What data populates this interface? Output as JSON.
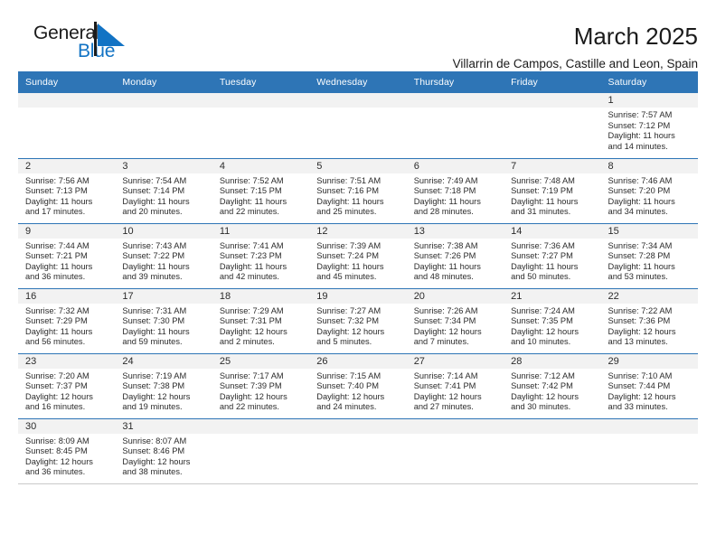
{
  "brand": {
    "name_part1": "General",
    "name_part2": "Blue",
    "logo_icon": "flag-triangle-icon",
    "color_primary": "#2e75b6",
    "color_text": "#1273c4"
  },
  "header": {
    "title": "March 2025",
    "subtitle": "Villarrin de Campos, Castille and Leon, Spain"
  },
  "weekdays": [
    "Sunday",
    "Monday",
    "Tuesday",
    "Wednesday",
    "Thursday",
    "Friday",
    "Saturday"
  ],
  "labels": {
    "sunrise": "Sunrise:",
    "sunset": "Sunset:",
    "daylight": "Daylight:"
  },
  "weeks": [
    [
      {
        "empty": true
      },
      {
        "empty": true
      },
      {
        "empty": true
      },
      {
        "empty": true
      },
      {
        "empty": true
      },
      {
        "empty": true
      },
      {
        "day": "1",
        "sunrise": "Sunrise: 7:57 AM",
        "sunset": "Sunset: 7:12 PM",
        "daylight1": "Daylight: 11 hours",
        "daylight2": "and 14 minutes."
      }
    ],
    [
      {
        "day": "2",
        "sunrise": "Sunrise: 7:56 AM",
        "sunset": "Sunset: 7:13 PM",
        "daylight1": "Daylight: 11 hours",
        "daylight2": "and 17 minutes."
      },
      {
        "day": "3",
        "sunrise": "Sunrise: 7:54 AM",
        "sunset": "Sunset: 7:14 PM",
        "daylight1": "Daylight: 11 hours",
        "daylight2": "and 20 minutes."
      },
      {
        "day": "4",
        "sunrise": "Sunrise: 7:52 AM",
        "sunset": "Sunset: 7:15 PM",
        "daylight1": "Daylight: 11 hours",
        "daylight2": "and 22 minutes."
      },
      {
        "day": "5",
        "sunrise": "Sunrise: 7:51 AM",
        "sunset": "Sunset: 7:16 PM",
        "daylight1": "Daylight: 11 hours",
        "daylight2": "and 25 minutes."
      },
      {
        "day": "6",
        "sunrise": "Sunrise: 7:49 AM",
        "sunset": "Sunset: 7:18 PM",
        "daylight1": "Daylight: 11 hours",
        "daylight2": "and 28 minutes."
      },
      {
        "day": "7",
        "sunrise": "Sunrise: 7:48 AM",
        "sunset": "Sunset: 7:19 PM",
        "daylight1": "Daylight: 11 hours",
        "daylight2": "and 31 minutes."
      },
      {
        "day": "8",
        "sunrise": "Sunrise: 7:46 AM",
        "sunset": "Sunset: 7:20 PM",
        "daylight1": "Daylight: 11 hours",
        "daylight2": "and 34 minutes."
      }
    ],
    [
      {
        "day": "9",
        "sunrise": "Sunrise: 7:44 AM",
        "sunset": "Sunset: 7:21 PM",
        "daylight1": "Daylight: 11 hours",
        "daylight2": "and 36 minutes."
      },
      {
        "day": "10",
        "sunrise": "Sunrise: 7:43 AM",
        "sunset": "Sunset: 7:22 PM",
        "daylight1": "Daylight: 11 hours",
        "daylight2": "and 39 minutes."
      },
      {
        "day": "11",
        "sunrise": "Sunrise: 7:41 AM",
        "sunset": "Sunset: 7:23 PM",
        "daylight1": "Daylight: 11 hours",
        "daylight2": "and 42 minutes."
      },
      {
        "day": "12",
        "sunrise": "Sunrise: 7:39 AM",
        "sunset": "Sunset: 7:24 PM",
        "daylight1": "Daylight: 11 hours",
        "daylight2": "and 45 minutes."
      },
      {
        "day": "13",
        "sunrise": "Sunrise: 7:38 AM",
        "sunset": "Sunset: 7:26 PM",
        "daylight1": "Daylight: 11 hours",
        "daylight2": "and 48 minutes."
      },
      {
        "day": "14",
        "sunrise": "Sunrise: 7:36 AM",
        "sunset": "Sunset: 7:27 PM",
        "daylight1": "Daylight: 11 hours",
        "daylight2": "and 50 minutes."
      },
      {
        "day": "15",
        "sunrise": "Sunrise: 7:34 AM",
        "sunset": "Sunset: 7:28 PM",
        "daylight1": "Daylight: 11 hours",
        "daylight2": "and 53 minutes."
      }
    ],
    [
      {
        "day": "16",
        "sunrise": "Sunrise: 7:32 AM",
        "sunset": "Sunset: 7:29 PM",
        "daylight1": "Daylight: 11 hours",
        "daylight2": "and 56 minutes."
      },
      {
        "day": "17",
        "sunrise": "Sunrise: 7:31 AM",
        "sunset": "Sunset: 7:30 PM",
        "daylight1": "Daylight: 11 hours",
        "daylight2": "and 59 minutes."
      },
      {
        "day": "18",
        "sunrise": "Sunrise: 7:29 AM",
        "sunset": "Sunset: 7:31 PM",
        "daylight1": "Daylight: 12 hours",
        "daylight2": "and 2 minutes."
      },
      {
        "day": "19",
        "sunrise": "Sunrise: 7:27 AM",
        "sunset": "Sunset: 7:32 PM",
        "daylight1": "Daylight: 12 hours",
        "daylight2": "and 5 minutes."
      },
      {
        "day": "20",
        "sunrise": "Sunrise: 7:26 AM",
        "sunset": "Sunset: 7:34 PM",
        "daylight1": "Daylight: 12 hours",
        "daylight2": "and 7 minutes."
      },
      {
        "day": "21",
        "sunrise": "Sunrise: 7:24 AM",
        "sunset": "Sunset: 7:35 PM",
        "daylight1": "Daylight: 12 hours",
        "daylight2": "and 10 minutes."
      },
      {
        "day": "22",
        "sunrise": "Sunrise: 7:22 AM",
        "sunset": "Sunset: 7:36 PM",
        "daylight1": "Daylight: 12 hours",
        "daylight2": "and 13 minutes."
      }
    ],
    [
      {
        "day": "23",
        "sunrise": "Sunrise: 7:20 AM",
        "sunset": "Sunset: 7:37 PM",
        "daylight1": "Daylight: 12 hours",
        "daylight2": "and 16 minutes."
      },
      {
        "day": "24",
        "sunrise": "Sunrise: 7:19 AM",
        "sunset": "Sunset: 7:38 PM",
        "daylight1": "Daylight: 12 hours",
        "daylight2": "and 19 minutes."
      },
      {
        "day": "25",
        "sunrise": "Sunrise: 7:17 AM",
        "sunset": "Sunset: 7:39 PM",
        "daylight1": "Daylight: 12 hours",
        "daylight2": "and 22 minutes."
      },
      {
        "day": "26",
        "sunrise": "Sunrise: 7:15 AM",
        "sunset": "Sunset: 7:40 PM",
        "daylight1": "Daylight: 12 hours",
        "daylight2": "and 24 minutes."
      },
      {
        "day": "27",
        "sunrise": "Sunrise: 7:14 AM",
        "sunset": "Sunset: 7:41 PM",
        "daylight1": "Daylight: 12 hours",
        "daylight2": "and 27 minutes."
      },
      {
        "day": "28",
        "sunrise": "Sunrise: 7:12 AM",
        "sunset": "Sunset: 7:42 PM",
        "daylight1": "Daylight: 12 hours",
        "daylight2": "and 30 minutes."
      },
      {
        "day": "29",
        "sunrise": "Sunrise: 7:10 AM",
        "sunset": "Sunset: 7:44 PM",
        "daylight1": "Daylight: 12 hours",
        "daylight2": "and 33 minutes."
      }
    ],
    [
      {
        "day": "30",
        "sunrise": "Sunrise: 8:09 AM",
        "sunset": "Sunset: 8:45 PM",
        "daylight1": "Daylight: 12 hours",
        "daylight2": "and 36 minutes."
      },
      {
        "day": "31",
        "sunrise": "Sunrise: 8:07 AM",
        "sunset": "Sunset: 8:46 PM",
        "daylight1": "Daylight: 12 hours",
        "daylight2": "and 38 minutes."
      },
      {
        "empty": true
      },
      {
        "empty": true
      },
      {
        "empty": true
      },
      {
        "empty": true
      },
      {
        "empty": true
      }
    ]
  ]
}
